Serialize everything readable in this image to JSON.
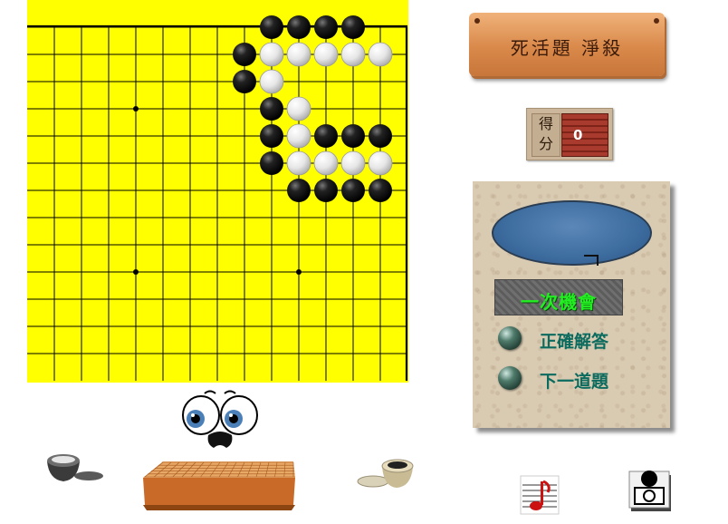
{
  "board": {
    "size": 19,
    "visible_columns": 14,
    "visible_rows": 14,
    "star_points": [
      [
        4,
        4
      ],
      [
        4,
        10
      ],
      [
        10,
        10
      ]
    ],
    "black_stones": [
      [
        9,
        1
      ],
      [
        10,
        1
      ],
      [
        11,
        1
      ],
      [
        12,
        1
      ],
      [
        8,
        2
      ],
      [
        8,
        3
      ],
      [
        9,
        4
      ],
      [
        9,
        5
      ],
      [
        11,
        5
      ],
      [
        12,
        5
      ],
      [
        13,
        5
      ],
      [
        9,
        6
      ],
      [
        10,
        7
      ],
      [
        11,
        7
      ],
      [
        12,
        7
      ],
      [
        13,
        7
      ]
    ],
    "white_stones": [
      [
        9,
        2
      ],
      [
        10,
        2
      ],
      [
        11,
        2
      ],
      [
        12,
        2
      ],
      [
        13,
        2
      ],
      [
        9,
        3
      ],
      [
        10,
        4
      ],
      [
        10,
        5
      ],
      [
        10,
        6
      ],
      [
        11,
        6
      ],
      [
        12,
        6
      ],
      [
        13,
        6
      ]
    ],
    "colors": {
      "surface": "#ffff00",
      "line": "#000000"
    }
  },
  "title_plank": {
    "text": "死活題 淨殺"
  },
  "score": {
    "label": "得分",
    "value": "0"
  },
  "panel": {
    "chance_label": "一次機會",
    "buttons": [
      {
        "label": "正確解答"
      },
      {
        "label": "下一道題"
      }
    ]
  },
  "icons": {
    "face": "cartoon-face-icon",
    "bowl_left": "black-stone-bowl-icon",
    "bowl_right": "white-stone-bowl-icon",
    "goban": "go-board-icon",
    "music": "music-note-icon",
    "stone": "stone-toggle-icon"
  }
}
